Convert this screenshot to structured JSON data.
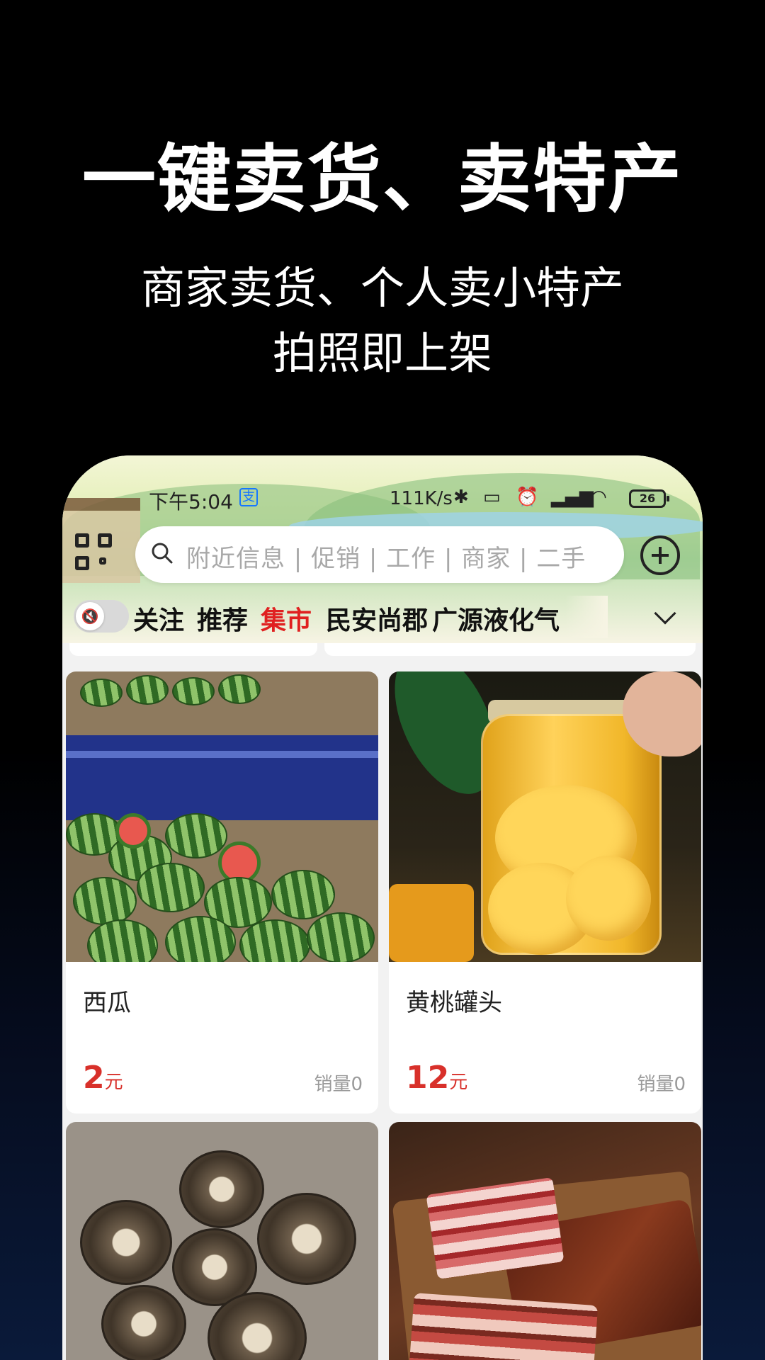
{
  "promo": {
    "headline": "一键卖货、卖特产",
    "subline1": "商家卖货、个人卖小特产",
    "subline2": "拍照即上架"
  },
  "statusbar": {
    "time": "下午5:04",
    "network_speed": "111K/s",
    "battery": "26"
  },
  "search": {
    "placeholder": "附近信息 | 促销 | 工作 | 商家 | 二手"
  },
  "tabs": [
    {
      "label": "关注",
      "active": false
    },
    {
      "label": "推荐",
      "active": false
    },
    {
      "label": "集市",
      "active": true
    },
    {
      "label": "民安尚郡",
      "active": false
    },
    {
      "label": "广源液化气",
      "active": false
    }
  ],
  "products": [
    {
      "title": "西瓜",
      "price": "2",
      "unit": "元",
      "sales": "销量0"
    },
    {
      "title": "黄桃罐头",
      "price": "12",
      "unit": "元",
      "sales": "销量0"
    },
    {
      "title": "",
      "price": "",
      "unit": "",
      "sales": ""
    },
    {
      "title": "",
      "price": "",
      "unit": "",
      "sales": ""
    }
  ],
  "colors": {
    "accent": "#e02020",
    "price": "#d8302a",
    "background": "#000000"
  }
}
